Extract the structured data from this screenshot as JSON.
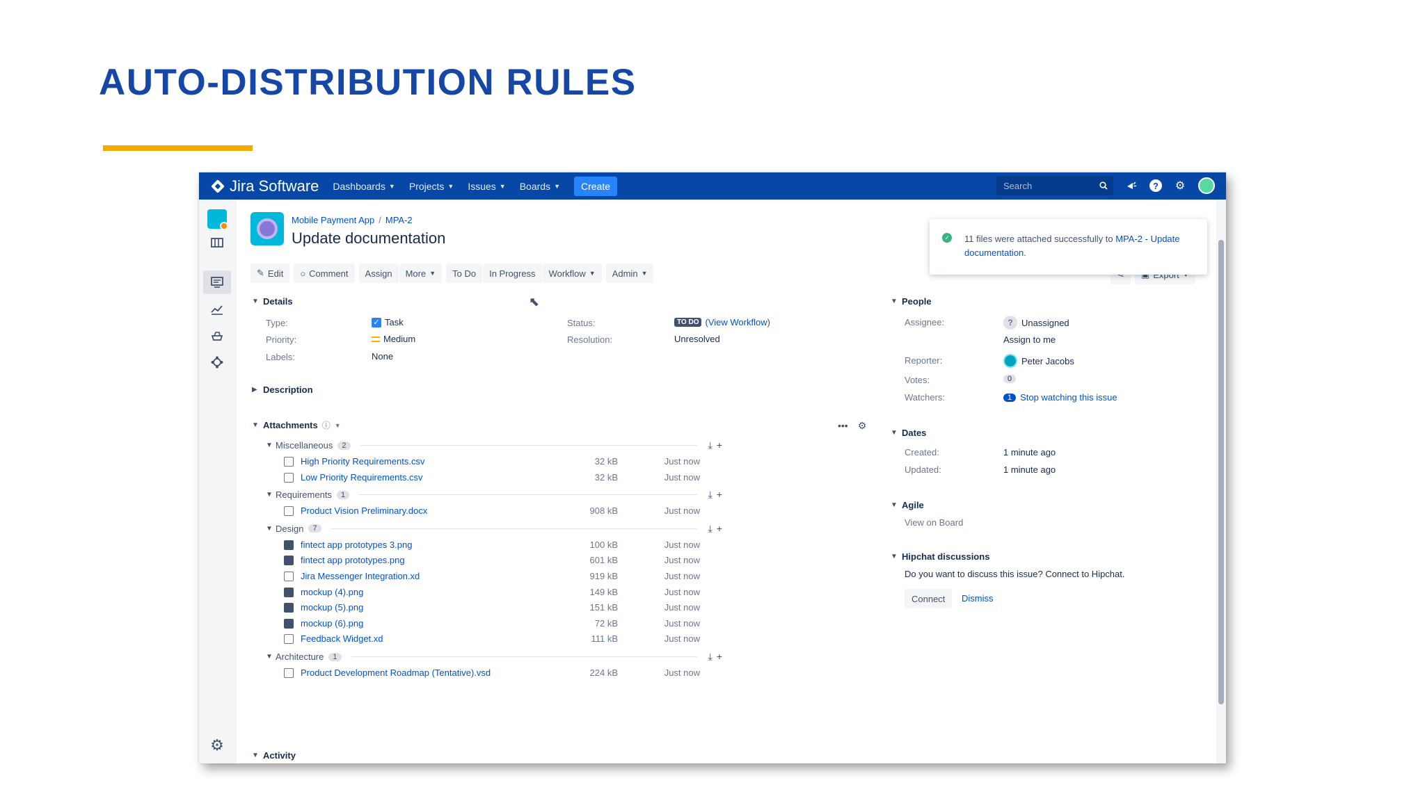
{
  "slide": {
    "title": "AUTO-DISTRIBUTION RULES"
  },
  "nav": {
    "logo": "Jira Software",
    "items": [
      "Dashboards",
      "Projects",
      "Issues",
      "Boards"
    ],
    "create": "Create",
    "search_placeholder": "Search"
  },
  "issue": {
    "project": "Mobile Payment App",
    "key": "MPA-2",
    "title": "Update documentation"
  },
  "toolbar": {
    "edit": "Edit",
    "comment": "Comment",
    "assign": "Assign",
    "more": "More",
    "todo": "To Do",
    "in_progress": "In Progress",
    "workflow": "Workflow",
    "admin": "Admin",
    "export": "Export"
  },
  "details": {
    "heading": "Details",
    "type_label": "Type:",
    "type_value": "Task",
    "priority_label": "Priority:",
    "priority_value": "Medium",
    "labels_label": "Labels:",
    "labels_value": "None",
    "status_label": "Status:",
    "status_value": "TO DO",
    "status_link": "(View Workflow)",
    "resolution_label": "Resolution:",
    "resolution_value": "Unresolved"
  },
  "description": {
    "heading": "Description"
  },
  "attachments": {
    "heading": "Attachments",
    "groups": [
      {
        "name": "Miscellaneous",
        "count": "2",
        "files": [
          {
            "name": "High Priority Requirements.csv",
            "size": "32 kB",
            "date": "Just now",
            "kind": "table"
          },
          {
            "name": "Low Priority Requirements.csv",
            "size": "32 kB",
            "date": "Just now",
            "kind": "table"
          }
        ]
      },
      {
        "name": "Requirements",
        "count": "1",
        "files": [
          {
            "name": "Product Vision Preliminary.docx",
            "size": "908 kB",
            "date": "Just now",
            "kind": "doc"
          }
        ]
      },
      {
        "name": "Design",
        "count": "7",
        "files": [
          {
            "name": "fintect app prototypes 3.png",
            "size": "100 kB",
            "date": "Just now",
            "kind": "img"
          },
          {
            "name": "fintect app prototypes.png",
            "size": "601 kB",
            "date": "Just now",
            "kind": "img"
          },
          {
            "name": "Jira Messenger Integration.xd",
            "size": "919 kB",
            "date": "Just now",
            "kind": "doc"
          },
          {
            "name": "mockup (4).png",
            "size": "149 kB",
            "date": "Just now",
            "kind": "img"
          },
          {
            "name": "mockup (5).png",
            "size": "151 kB",
            "date": "Just now",
            "kind": "img"
          },
          {
            "name": "mockup (6).png",
            "size": "72 kB",
            "date": "Just now",
            "kind": "img"
          },
          {
            "name": "Feedback Widget.xd",
            "size": "111 kB",
            "date": "Just now",
            "kind": "doc"
          }
        ]
      },
      {
        "name": "Architecture",
        "count": "1",
        "files": [
          {
            "name": "Product Development Roadmap (Tentative).vsd",
            "size": "224 kB",
            "date": "Just now",
            "kind": "doc"
          }
        ]
      }
    ]
  },
  "activity": {
    "heading": "Activity"
  },
  "people": {
    "heading": "People",
    "assignee_label": "Assignee:",
    "assignee_value": "Unassigned",
    "assign_to_me": "Assign to me",
    "reporter_label": "Reporter:",
    "reporter_value": "Peter Jacobs",
    "votes_label": "Votes:",
    "votes_value": "0",
    "watchers_label": "Watchers:",
    "watchers_count": "1",
    "watchers_link": "Stop watching this issue"
  },
  "dates": {
    "heading": "Dates",
    "created_label": "Created:",
    "created_value": "1 minute ago",
    "updated_label": "Updated:",
    "updated_value": "1 minute ago"
  },
  "agile": {
    "heading": "Agile",
    "link": "View on Board"
  },
  "hipchat": {
    "heading": "Hipchat discussions",
    "text": "Do you want to discuss this issue? Connect to Hipchat.",
    "connect": "Connect",
    "dismiss": "Dismiss"
  },
  "flag": {
    "text_prefix": "11 files were attached successfully to ",
    "text_link": "MPA-2 - Update documentation."
  },
  "colors": {
    "brand": "#0747a6",
    "accent": "#f2a900",
    "title": "#1747a6",
    "link": "#0052cc"
  }
}
